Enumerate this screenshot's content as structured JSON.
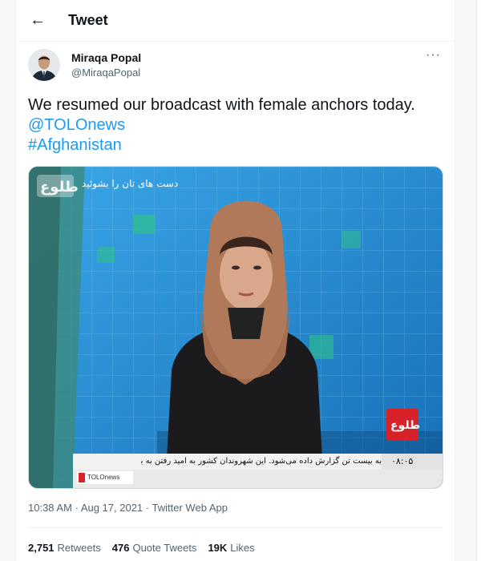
{
  "header": {
    "title": "Tweet",
    "back_icon": "arrow-left-icon"
  },
  "author": {
    "name": "Miraqa Popal",
    "handle": "@MiraqaPopal"
  },
  "tweet": {
    "text": "We resumed our broadcast with female anchors today.",
    "mention": "@TOLOnews",
    "hashtag": "#Afghanistan"
  },
  "media": {
    "top_caption": "دست های تان را بشوئید",
    "ticker": "به بیست تن گزارش داده می‌شود. این شهروندان کشور به امید رفتن به بیرون",
    "time": "۰۸:۰۵",
    "source": "TOLOnews"
  },
  "meta": {
    "time": "10:38 AM",
    "date": "Aug 17, 2021",
    "sep": "·",
    "client": "Twitter Web App"
  },
  "stats": {
    "retweets_count": "2,751",
    "retweets_label": "Retweets",
    "quotes_count": "476",
    "quotes_label": "Quote Tweets",
    "likes_count": "19K",
    "likes_label": "Likes"
  },
  "colors": {
    "link": "#1d9bf0",
    "secondary": "#536471",
    "studio_blue": "#1e8fd6"
  }
}
